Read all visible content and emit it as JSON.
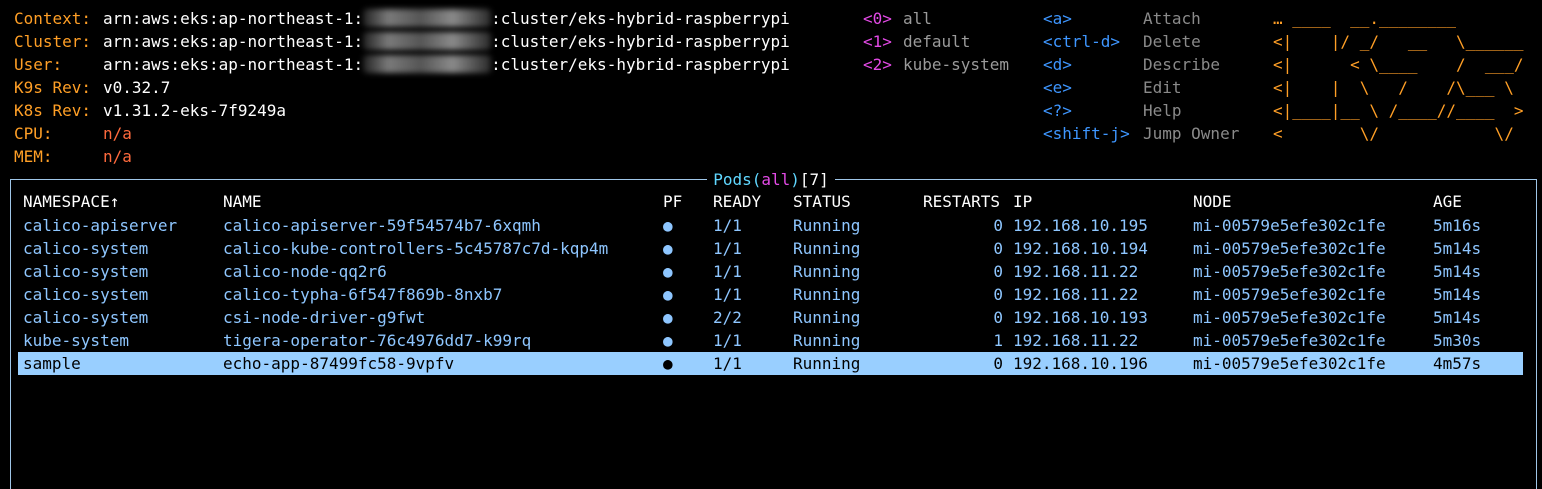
{
  "header": {
    "context_label": "Context:",
    "context_prefix": "arn:aws:eks:ap-northeast-1:",
    "context_suffix": ":cluster/eks-hybrid-raspberrypi",
    "cluster_label": "Cluster:",
    "cluster_prefix": "arn:aws:eks:ap-northeast-1:",
    "cluster_suffix": ":cluster/eks-hybrid-raspberrypi",
    "user_label": "User:",
    "user_prefix": "arn:aws:eks:ap-northeast-1:",
    "user_suffix": ":cluster/eks-hybrid-raspberrypi",
    "k9s_label": "K9s Rev:",
    "k9s_value": "v0.32.7",
    "k8s_label": "K8s Rev:",
    "k8s_value": "v1.31.2-eks-7f9249a",
    "cpu_label": "CPU:",
    "cpu_value": "n/a",
    "mem_label": "MEM:",
    "mem_value": "n/a"
  },
  "namespaces": [
    {
      "key": "<0>",
      "label": "all"
    },
    {
      "key": "<1>",
      "label": "default"
    },
    {
      "key": "<2>",
      "label": "kube-system"
    }
  ],
  "shortcuts": [
    {
      "key": "<a>",
      "label": "Attach"
    },
    {
      "key": "<ctrl-d>",
      "label": "Delete"
    },
    {
      "key": "<d>",
      "label": "Describe"
    },
    {
      "key": "<e>",
      "label": "Edit"
    },
    {
      "key": "<?>",
      "label": "Help"
    },
    {
      "key": "<shift-j>",
      "label": "Jump Owner"
    }
  ],
  "logo": {
    "lines": [
      "… ____  __.________       ",
      "<|    |/ _/   __   \\______",
      "<|      < \\____    /  ___/",
      "<|    |  \\   /    /\\___ \\ ",
      "<|____|__ \\ /____//____  >",
      "<        \\/            \\/ "
    ]
  },
  "table": {
    "title_resource": "Pods",
    "title_filter": "all",
    "title_count": "[7]",
    "title_open": "(",
    "title_close": ")",
    "columns": [
      "NAMESPACE↑",
      "NAME",
      "PF",
      "READY",
      "STATUS",
      "RESTARTS",
      "IP",
      "NODE",
      "AGE"
    ],
    "rows": [
      {
        "namespace": "calico-apiserver",
        "name": "calico-apiserver-59f54574b7-6xqmh",
        "pf": "●",
        "ready": "1/1",
        "status": "Running",
        "restarts": "0",
        "ip": "192.168.10.195",
        "node": "mi-00579e5efe302c1fe",
        "age": "5m16s"
      },
      {
        "namespace": "calico-system",
        "name": "calico-kube-controllers-5c45787c7d-kqp4m",
        "pf": "●",
        "ready": "1/1",
        "status": "Running",
        "restarts": "0",
        "ip": "192.168.10.194",
        "node": "mi-00579e5efe302c1fe",
        "age": "5m14s"
      },
      {
        "namespace": "calico-system",
        "name": "calico-node-qq2r6",
        "pf": "●",
        "ready": "1/1",
        "status": "Running",
        "restarts": "0",
        "ip": "192.168.11.22",
        "node": "mi-00579e5efe302c1fe",
        "age": "5m14s"
      },
      {
        "namespace": "calico-system",
        "name": "calico-typha-6f547f869b-8nxb7",
        "pf": "●",
        "ready": "1/1",
        "status": "Running",
        "restarts": "0",
        "ip": "192.168.11.22",
        "node": "mi-00579e5efe302c1fe",
        "age": "5m14s"
      },
      {
        "namespace": "calico-system",
        "name": "csi-node-driver-g9fwt",
        "pf": "●",
        "ready": "2/2",
        "status": "Running",
        "restarts": "0",
        "ip": "192.168.10.193",
        "node": "mi-00579e5efe302c1fe",
        "age": "5m14s"
      },
      {
        "namespace": "kube-system",
        "name": "tigera-operator-76c4976dd7-k99rq",
        "pf": "●",
        "ready": "1/1",
        "status": "Running",
        "restarts": "1",
        "ip": "192.168.11.22",
        "node": "mi-00579e5efe302c1fe",
        "age": "5m30s"
      },
      {
        "namespace": "sample",
        "name": "echo-app-87499fc58-9vpfv",
        "pf": "●",
        "ready": "1/1",
        "status": "Running",
        "restarts": "0",
        "ip": "192.168.10.196",
        "node": "mi-00579e5efe302c1fe",
        "age": "4m57s",
        "selected": true
      }
    ]
  },
  "colors": {
    "label": "#ff9f26",
    "namespace_key": "#e34ae6",
    "shortcut_key": "#3e96ff",
    "row_text": "#8ec6ff",
    "selected_bg": "#99cfff",
    "title": "#60d7ff",
    "frame": "#9fc6e8"
  }
}
